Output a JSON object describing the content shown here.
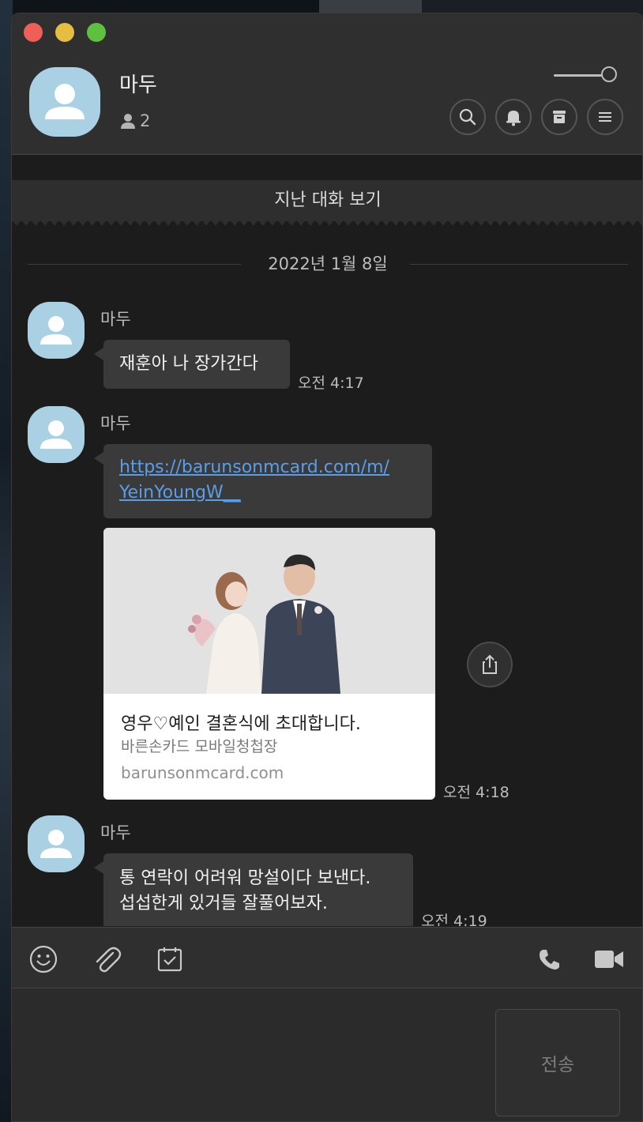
{
  "chat_room": {
    "name": "마두",
    "member_count": "2"
  },
  "banner": {
    "past_conversations_label": "지난 대화 보기"
  },
  "date_divider": "2022년 1월 8일",
  "messages": [
    {
      "sender": "마두",
      "text": "재훈아 나 장가간다",
      "time": "오전 4:17"
    },
    {
      "sender": "마두",
      "link_line1": "https://barunsonmcard.com/m/",
      "link_line2": "YeinYoungW__"
    },
    {
      "sender": "마두",
      "line1": "통 연락이 어려워 망설이다 보낸다.",
      "line2": "섭섭한게 있거들 잘풀어보자.",
      "time": "오전 4:19"
    }
  ],
  "link_preview": {
    "title": "영우♡예인 결혼식에 초대합니다.",
    "subtitle": "바른손카드 모바일청첩장",
    "domain": "barunsonmcard.com",
    "time": "오전 4:18"
  },
  "composer": {
    "send_label": "전송"
  },
  "icons": {
    "header": [
      "search-icon",
      "bell-icon",
      "archive-icon",
      "menu-icon"
    ],
    "toolbar": [
      "emoji-icon",
      "paperclip-icon",
      "calendar-icon",
      "phone-icon",
      "video-icon"
    ],
    "share": "share-icon"
  },
  "colors": {
    "avatar": "#a9d0e3",
    "link": "#5b9ee8"
  }
}
